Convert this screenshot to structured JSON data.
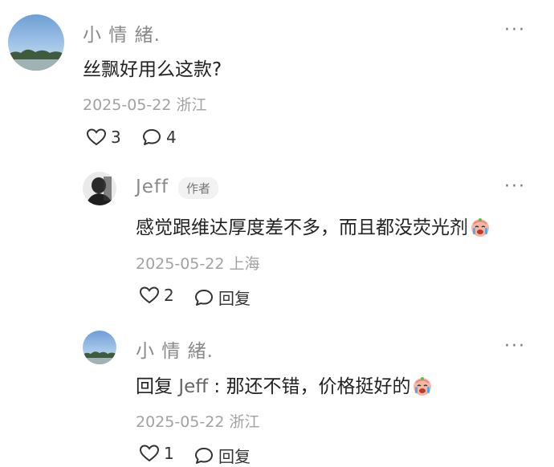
{
  "comment": {
    "author": "小 情 緒.",
    "text": "丝飘好用么这款?",
    "meta": "2025-05-22 浙江",
    "likes": "3",
    "replies": "4",
    "more": "···"
  },
  "replies": [
    {
      "author": "Jeff",
      "badge": "作者",
      "text": "感觉跟维达厚度差不多，而且都没荧光剂",
      "meta": "2025-05-22 上海",
      "likes": "2",
      "reply_label": "回复",
      "more": "···"
    },
    {
      "author": "小 情 緒.",
      "reply_prefix": "回复",
      "reply_to": "Jeff",
      "text_rest": ": 那还不错，价格挺好的",
      "meta": "2025-05-22 浙江",
      "likes": "1",
      "reply_label": "回复",
      "more": "···"
    }
  ],
  "colors": {
    "name": "#8a8a8a",
    "meta": "#a2a2a2",
    "text": "#222222"
  }
}
